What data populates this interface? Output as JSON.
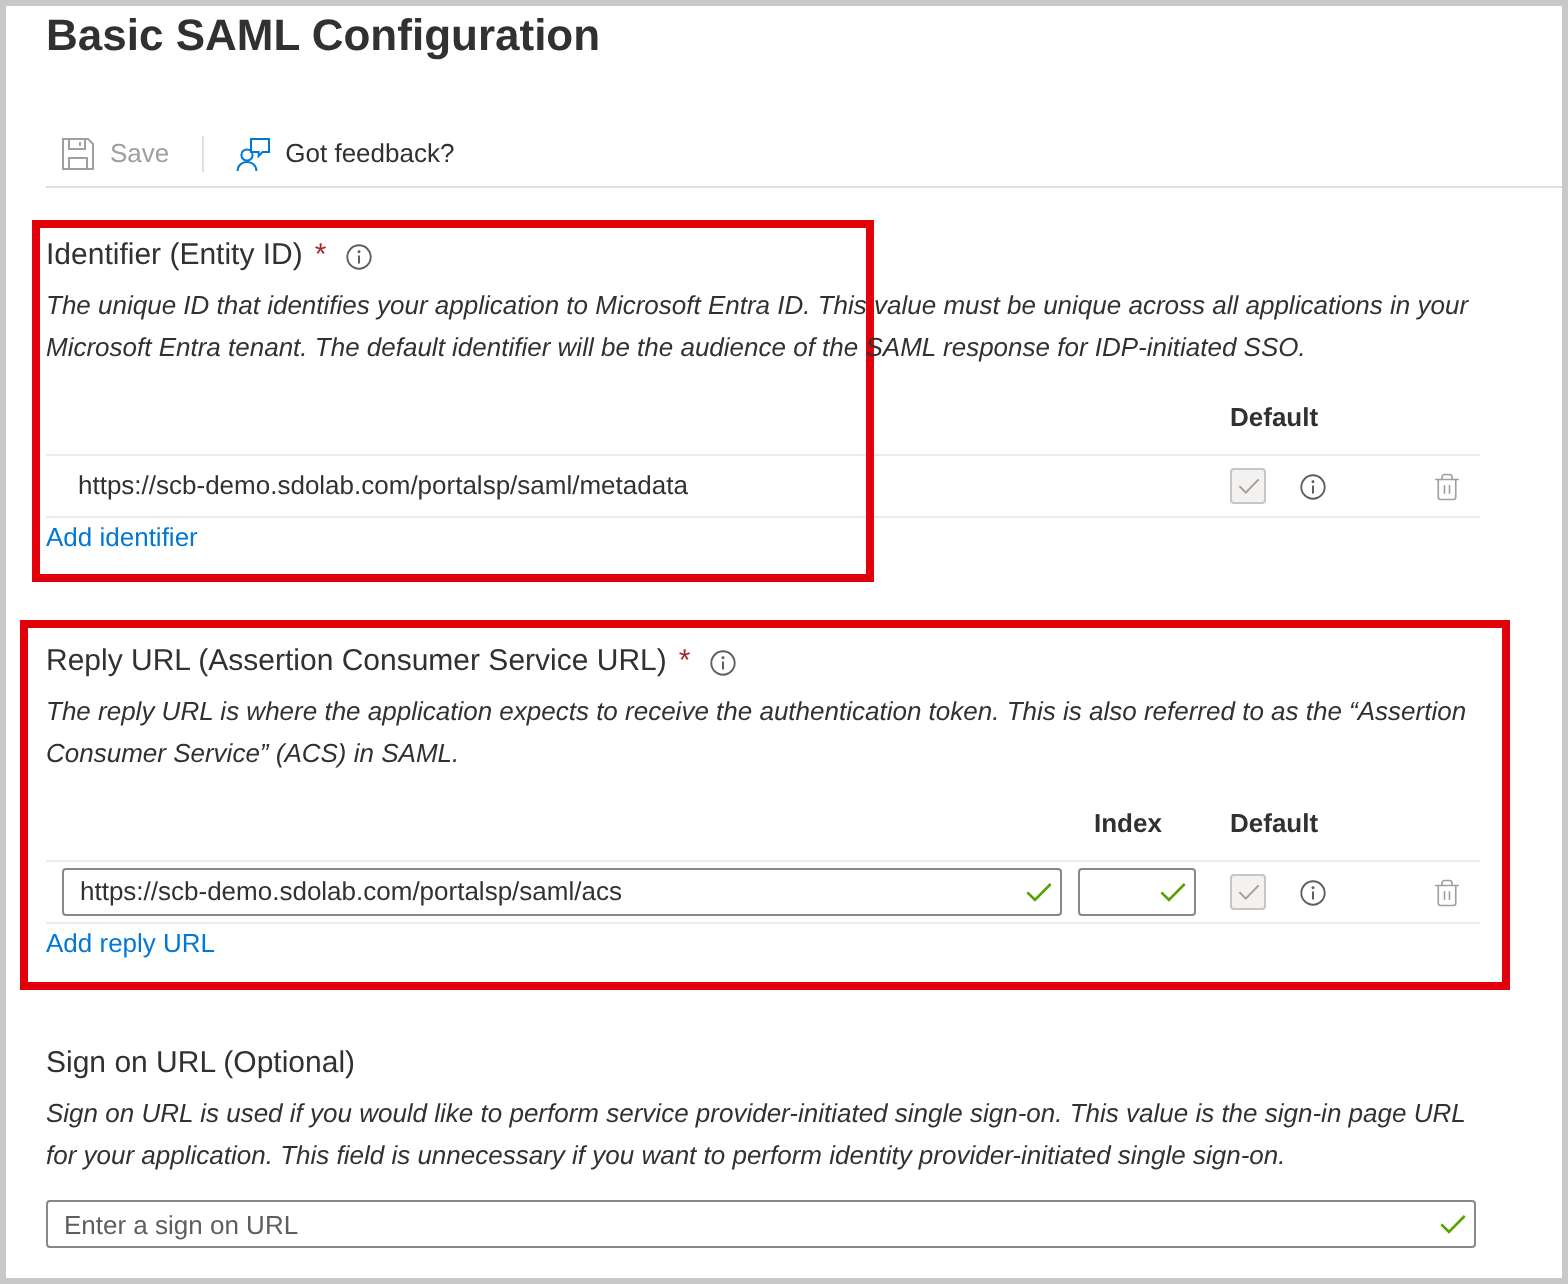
{
  "page": {
    "title": "Basic SAML Configuration"
  },
  "toolbar": [
    {
      "kind": "save",
      "label": "Save",
      "disabled": true
    },
    {
      "kind": "feedback",
      "label": "Got feedback?",
      "disabled": false
    }
  ],
  "sections": [
    {
      "kind": "list",
      "title": "Identifier (Entity ID)",
      "required_mark": "*",
      "info": true,
      "highlighted": true,
      "description": "The unique ID that identifies your application to Microsoft Entra ID. This value must be unique across all applications in your Microsoft Entra tenant. The default identifier will be the audience of the SAML response for IDP-initiated SSO.",
      "columns": [
        {
          "kind": "default",
          "label": "Default"
        }
      ],
      "rows": [
        {
          "url": {
            "kind": "text",
            "value": "https://scb-demo.sdolab.com/portalsp/saml/metadata"
          },
          "default": {
            "checked": true,
            "disabled": true
          },
          "delete_disabled": true
        }
      ],
      "add_link": "Add identifier"
    },
    {
      "kind": "list",
      "title": "Reply URL (Assertion Consumer Service URL)",
      "required_mark": "*",
      "info": true,
      "highlighted": true,
      "description": "The reply URL is where the application expects to receive the authentication token. This is also referred to as the “Assertion Consumer Service” (ACS) in SAML.",
      "columns": [
        {
          "kind": "index",
          "label": "Index"
        },
        {
          "kind": "default",
          "label": "Default"
        }
      ],
      "rows": [
        {
          "url": {
            "kind": "input",
            "value": "https://scb-demo.sdolab.com/portalsp/saml/acs",
            "valid": true
          },
          "index": {
            "valid": true
          },
          "default": {
            "checked": true,
            "disabled": true
          },
          "delete_disabled": true
        }
      ],
      "add_link": "Add reply URL"
    },
    {
      "kind": "single",
      "title": "Sign on URL (Optional)",
      "info": false,
      "highlighted": false,
      "description": "Sign on URL is used if you would like to perform service provider-initiated single sign-on. This value is the sign-in page URL for your application. This field is unnecessary if you want to perform identity provider-initiated single sign-on.",
      "field": {
        "placeholder": "Enter a sign on URL",
        "valid": true
      }
    }
  ]
}
